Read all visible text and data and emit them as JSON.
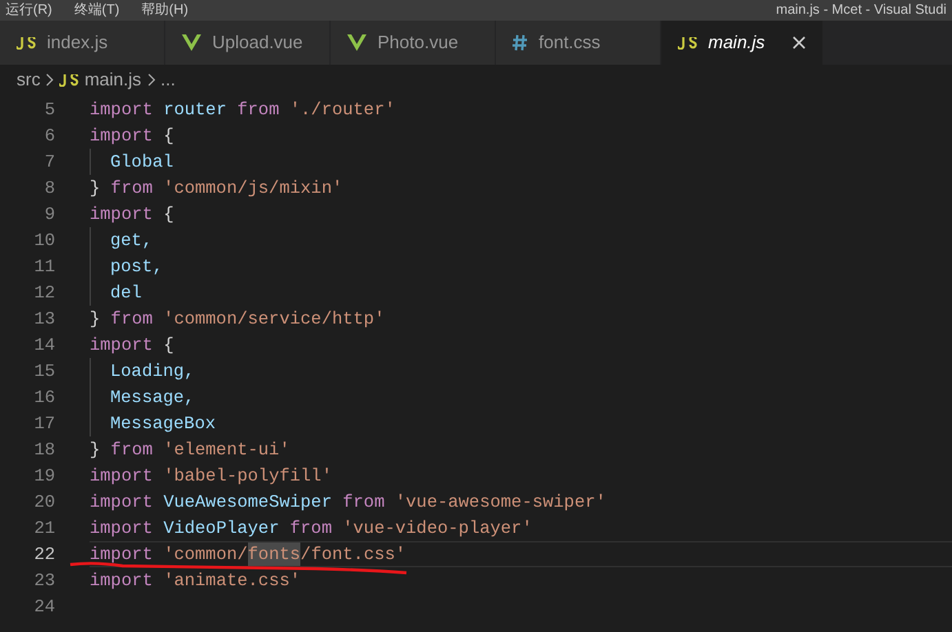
{
  "title_bar": {
    "menus": [
      "运行(R)",
      "终端(T)",
      "帮助(H)"
    ],
    "title": "main.js - Mcet - Visual Studi"
  },
  "tabs": [
    {
      "label": "index.js",
      "kind": "js",
      "selected": false,
      "italic": false
    },
    {
      "label": "Upload.vue",
      "kind": "vue",
      "selected": false,
      "italic": false
    },
    {
      "label": "Photo.vue",
      "kind": "vue",
      "selected": false,
      "italic": false
    },
    {
      "label": "font.css",
      "kind": "css",
      "selected": false,
      "italic": false
    },
    {
      "label": "main.js",
      "kind": "js",
      "selected": true,
      "italic": true
    }
  ],
  "breadcrumb": {
    "folder": "src",
    "file": "main.js",
    "kind": "js",
    "more": "..."
  },
  "lines": [
    {
      "number": "5",
      "indented": false,
      "current": false,
      "tokens": [
        {
          "kind": "keyword",
          "text": "import"
        },
        {
          "kind": "name",
          "text": "router"
        },
        {
          "kind": "keyword",
          "text": "from"
        },
        {
          "kind": "string",
          "text": "'./router'"
        }
      ]
    },
    {
      "number": "6",
      "indented": false,
      "current": false,
      "tokens": [
        {
          "kind": "keyword",
          "text": "import"
        },
        {
          "kind": "punct",
          "text": "{"
        }
      ]
    },
    {
      "number": "7",
      "indented": true,
      "current": false,
      "tokens": [
        {
          "kind": "name",
          "text": "Global"
        }
      ]
    },
    {
      "number": "8",
      "indented": false,
      "current": false,
      "tokens": [
        {
          "kind": "punct",
          "text": "}"
        },
        {
          "kind": "keyword",
          "text": "from"
        },
        {
          "kind": "string",
          "text": "'common/js/mixin'"
        }
      ]
    },
    {
      "number": "9",
      "indented": false,
      "current": false,
      "tokens": [
        {
          "kind": "keyword",
          "text": "import"
        },
        {
          "kind": "punct",
          "text": "{"
        }
      ]
    },
    {
      "number": "10",
      "indented": true,
      "current": false,
      "tokens": [
        {
          "kind": "name",
          "text": "get,"
        }
      ]
    },
    {
      "number": "11",
      "indented": true,
      "current": false,
      "tokens": [
        {
          "kind": "name",
          "text": "post,"
        }
      ]
    },
    {
      "number": "12",
      "indented": true,
      "current": false,
      "tokens": [
        {
          "kind": "name",
          "text": "del"
        }
      ]
    },
    {
      "number": "13",
      "indented": false,
      "current": false,
      "tokens": [
        {
          "kind": "punct",
          "text": "}"
        },
        {
          "kind": "keyword",
          "text": "from"
        },
        {
          "kind": "string",
          "text": "'common/service/http'"
        }
      ]
    },
    {
      "number": "14",
      "indented": false,
      "current": false,
      "tokens": [
        {
          "kind": "keyword",
          "text": "import"
        },
        {
          "kind": "punct",
          "text": "{"
        }
      ]
    },
    {
      "number": "15",
      "indented": true,
      "current": false,
      "tokens": [
        {
          "kind": "name",
          "text": "Loading,"
        }
      ]
    },
    {
      "number": "16",
      "indented": true,
      "current": false,
      "tokens": [
        {
          "kind": "name",
          "text": "Message,"
        }
      ]
    },
    {
      "number": "17",
      "indented": true,
      "current": false,
      "tokens": [
        {
          "kind": "name",
          "text": "MessageBox"
        }
      ]
    },
    {
      "number": "18",
      "indented": false,
      "current": false,
      "tokens": [
        {
          "kind": "punct",
          "text": "}"
        },
        {
          "kind": "keyword",
          "text": "from"
        },
        {
          "kind": "string",
          "text": "'element-ui'"
        }
      ]
    },
    {
      "number": "19",
      "indented": false,
      "current": false,
      "tokens": [
        {
          "kind": "keyword",
          "text": "import"
        },
        {
          "kind": "string",
          "text": "'babel-polyfill'"
        }
      ]
    },
    {
      "number": "20",
      "indented": false,
      "current": false,
      "tokens": [
        {
          "kind": "keyword",
          "text": "import"
        },
        {
          "kind": "name",
          "text": "VueAwesomeSwiper"
        },
        {
          "kind": "keyword",
          "text": "from"
        },
        {
          "kind": "string",
          "text": "'vue-awesome-swiper'"
        }
      ]
    },
    {
      "number": "21",
      "indented": false,
      "current": false,
      "tokens": [
        {
          "kind": "keyword",
          "text": "import"
        },
        {
          "kind": "name",
          "text": "VideoPlayer"
        },
        {
          "kind": "keyword",
          "text": "from"
        },
        {
          "kind": "string",
          "text": "'vue-video-player'"
        }
      ]
    },
    {
      "number": "22",
      "indented": false,
      "current": true,
      "underlined": true,
      "tokens": [
        {
          "kind": "keyword",
          "text": "import"
        },
        {
          "kind": "string",
          "parts": [
            {
              "text": "'common/",
              "highlighted": false
            },
            {
              "text": "fonts",
              "highlighted": true
            },
            {
              "text": "/font.css'",
              "highlighted": false
            }
          ]
        }
      ]
    },
    {
      "number": "23",
      "indented": false,
      "current": false,
      "tokens": [
        {
          "kind": "keyword",
          "text": "import"
        },
        {
          "kind": "string",
          "text": "'animate.css'"
        }
      ]
    },
    {
      "number": "24",
      "current": false
    }
  ]
}
